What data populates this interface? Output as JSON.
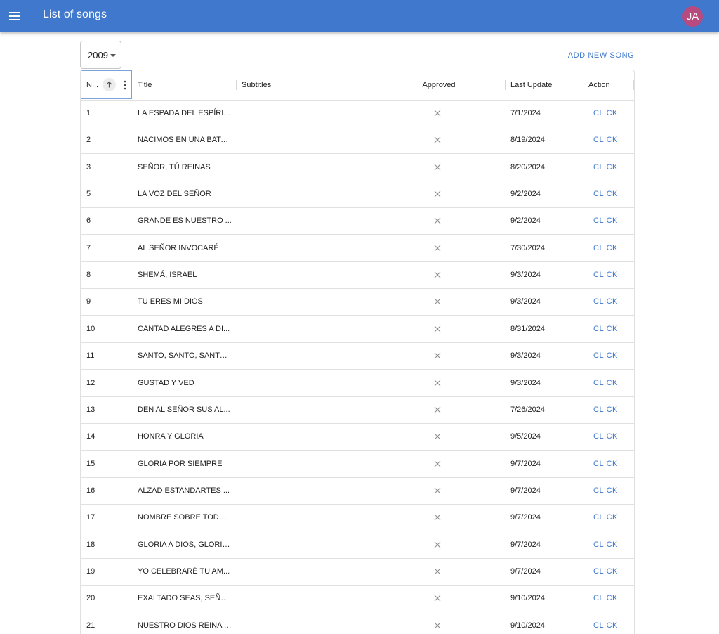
{
  "appbar": {
    "title": "List of songs",
    "avatar_initials": "JA",
    "menu_icon": "menu-icon"
  },
  "filter": {
    "year": "2009"
  },
  "toolbar": {
    "add_label": "ADD NEW SONG"
  },
  "table": {
    "columns": {
      "number": "N...",
      "title": "Title",
      "subtitles": "Subtitles",
      "approved": "Approved",
      "last_update": "Last Update",
      "action": "Action"
    },
    "sort_icon": "arrow-up-icon",
    "menu_icon": "kebab-icon",
    "rows": [
      {
        "number": "1",
        "title": "LA ESPADA DEL ESPÍRITU",
        "subtitles": "",
        "approved": false,
        "last_update": "7/1/2024",
        "action": "CLICK"
      },
      {
        "number": "2",
        "title": "NACIMOS EN UNA BATA...",
        "subtitles": "",
        "approved": false,
        "last_update": "8/19/2024",
        "action": "CLICK"
      },
      {
        "number": "3",
        "title": "SEÑOR, TÚ REINAS",
        "subtitles": "",
        "approved": false,
        "last_update": "8/20/2024",
        "action": "CLICK"
      },
      {
        "number": "5",
        "title": "LA VOZ DEL SEÑOR",
        "subtitles": "",
        "approved": false,
        "last_update": "9/2/2024",
        "action": "CLICK"
      },
      {
        "number": "6",
        "title": "GRANDE ES NUESTRO ...",
        "subtitles": "",
        "approved": false,
        "last_update": "9/2/2024",
        "action": "CLICK"
      },
      {
        "number": "7",
        "title": "AL SEÑOR INVOCARÉ",
        "subtitles": "",
        "approved": false,
        "last_update": "7/30/2024",
        "action": "CLICK"
      },
      {
        "number": "8",
        "title": "SHEMÁ, ISRAEL",
        "subtitles": "",
        "approved": false,
        "last_update": "9/3/2024",
        "action": "CLICK"
      },
      {
        "number": "9",
        "title": "TÚ ERES MI DIOS",
        "subtitles": "",
        "approved": false,
        "last_update": "9/3/2024",
        "action": "CLICK"
      },
      {
        "number": "10",
        "title": "CANTAD ALEGRES A DI...",
        "subtitles": "",
        "approved": false,
        "last_update": "8/31/2024",
        "action": "CLICK"
      },
      {
        "number": "11",
        "title": "SANTO, SANTO, SANTO...",
        "subtitles": "",
        "approved": false,
        "last_update": "9/3/2024",
        "action": "CLICK"
      },
      {
        "number": "12",
        "title": "GUSTAD Y VED",
        "subtitles": "",
        "approved": false,
        "last_update": "9/3/2024",
        "action": "CLICK"
      },
      {
        "number": "13",
        "title": "DEN AL SEÑOR SUS AL...",
        "subtitles": "",
        "approved": false,
        "last_update": "7/26/2024",
        "action": "CLICK"
      },
      {
        "number": "14",
        "title": "HONRA Y GLORIA",
        "subtitles": "",
        "approved": false,
        "last_update": "9/5/2024",
        "action": "CLICK"
      },
      {
        "number": "15",
        "title": "GLORIA POR SIEMPRE",
        "subtitles": "",
        "approved": false,
        "last_update": "9/7/2024",
        "action": "CLICK"
      },
      {
        "number": "16",
        "title": "ALZAD ESTANDARTES ...",
        "subtitles": "",
        "approved": false,
        "last_update": "9/7/2024",
        "action": "CLICK"
      },
      {
        "number": "17",
        "title": "NOMBRE SOBRE TODO ...",
        "subtitles": "",
        "approved": false,
        "last_update": "9/7/2024",
        "action": "CLICK"
      },
      {
        "number": "18",
        "title": "GLORIA A DIOS, GLORIA...",
        "subtitles": "",
        "approved": false,
        "last_update": "9/7/2024",
        "action": "CLICK"
      },
      {
        "number": "19",
        "title": "YO CELEBRARÉ TU AM...",
        "subtitles": "",
        "approved": false,
        "last_update": "9/7/2024",
        "action": "CLICK"
      },
      {
        "number": "20",
        "title": "EXALTADO SEAS, SEÑOR",
        "subtitles": "",
        "approved": false,
        "last_update": "9/10/2024",
        "action": "CLICK"
      },
      {
        "number": "21",
        "title": "NUESTRO DIOS REINA YA",
        "subtitles": "",
        "approved": false,
        "last_update": "9/10/2024",
        "action": "CLICK"
      }
    ]
  },
  "colors": {
    "appbar": "#3f78cc",
    "accent": "#3f78cc",
    "avatar": "#b94a7f",
    "divider": "#e0e0e0"
  }
}
